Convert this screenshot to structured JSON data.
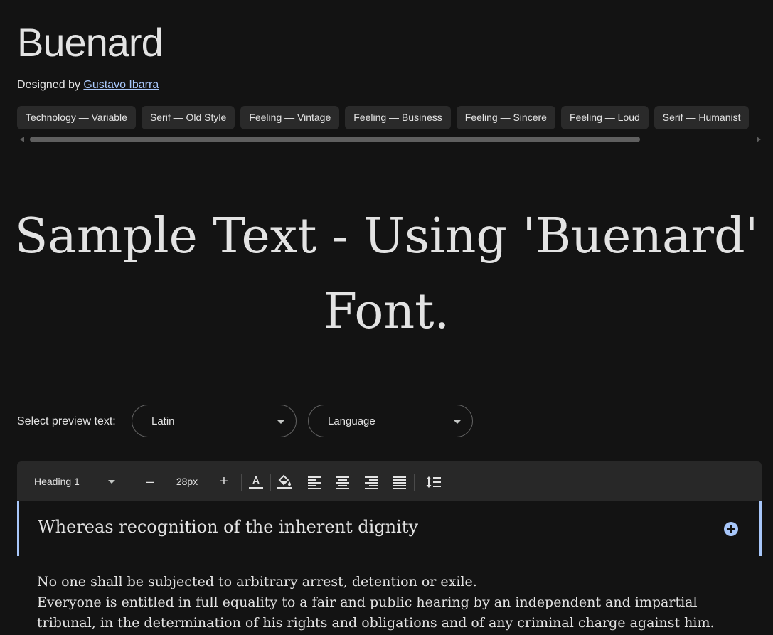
{
  "header": {
    "title": "Buenard",
    "designed_by_prefix": "Designed by ",
    "designer_name": "Gustavo Ibarra"
  },
  "tags": [
    "Technology — Variable",
    "Serif — Old Style",
    "Feeling — Vintage",
    "Feeling — Business",
    "Feeling — Sincere",
    "Feeling — Loud",
    "Serif — Humanist"
  ],
  "sample": {
    "line1": "Sample Text - Using 'Buenard'",
    "line2": "Font."
  },
  "preview": {
    "label": "Select preview text:",
    "script_value": "Latin",
    "language_placeholder": "Language"
  },
  "toolbar": {
    "style_value": "Heading 1",
    "decrease_label": "–",
    "size_value": "28px",
    "increase_label": "+"
  },
  "editor": {
    "heading": "Whereas recognition of the inherent dignity",
    "paragraphs": [
      "No one shall be subjected to arbitrary arrest, detention or exile.",
      "Everyone is entitled in full equality to a fair and public hearing by an independent and impartial tribunal, in the determination of his rights and obligations and of any criminal charge against him."
    ]
  },
  "colors": {
    "background": "#131313",
    "text": "#e3e3e3",
    "accent": "#a8c7fa",
    "chip": "#2a2a2a",
    "toolbar": "#282828"
  }
}
